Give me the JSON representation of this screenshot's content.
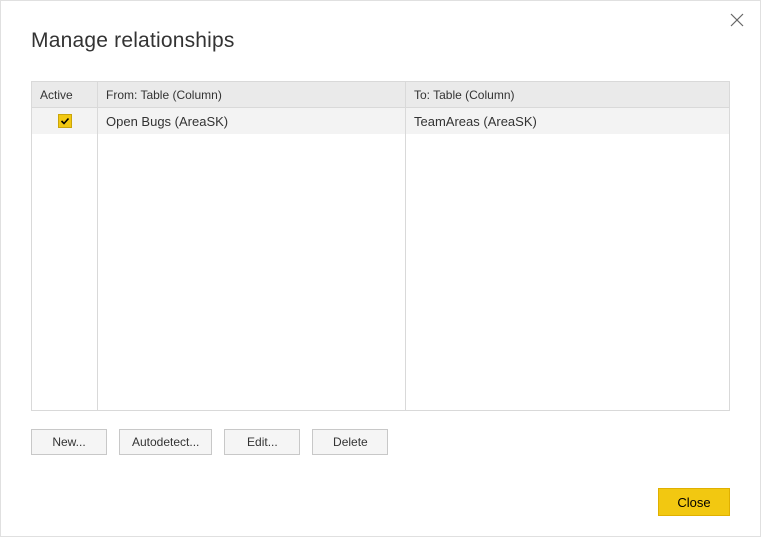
{
  "dialog": {
    "title": "Manage relationships"
  },
  "table": {
    "headers": {
      "active": "Active",
      "from": "From: Table (Column)",
      "to": "To: Table (Column)"
    },
    "rows": [
      {
        "active": true,
        "from": "Open Bugs (AreaSK)",
        "to": "TeamAreas (AreaSK)"
      }
    ]
  },
  "buttons": {
    "new": "New...",
    "autodetect": "Autodetect...",
    "edit": "Edit...",
    "delete": "Delete",
    "close": "Close"
  }
}
